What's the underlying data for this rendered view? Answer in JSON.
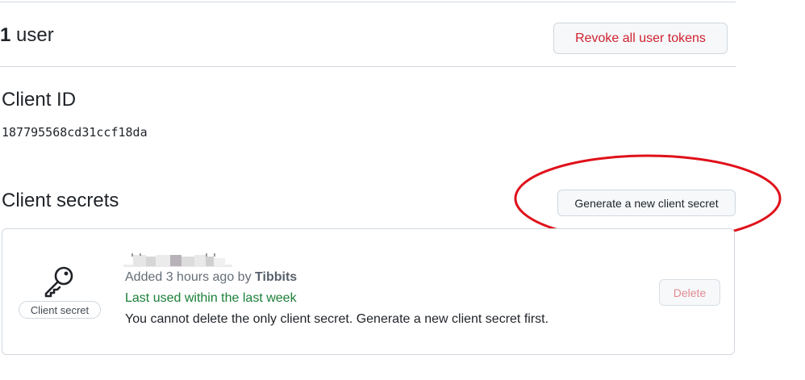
{
  "users": {
    "count": "1",
    "label": " user",
    "revoke_button": "Revoke all user tokens"
  },
  "client_id": {
    "heading": "Client ID",
    "value": "187795568cd31ccf18da"
  },
  "client_secrets": {
    "heading": "Client secrets",
    "generate_button": "Generate a new client secret",
    "secret": {
      "badge": "Client secret",
      "added_prefix": "Added 3 hours ago by ",
      "added_by": "Tibbits",
      "last_used": "Last used within the last week",
      "warning": "You cannot delete the only client secret. Generate a new client secret first.",
      "delete_button": "Delete"
    }
  },
  "colors": {
    "danger": "#cf222e",
    "success": "#1a7f37",
    "border": "#d0d7de",
    "annotation": "#e0101a"
  },
  "icons": {
    "secret_icon": "key-icon"
  }
}
